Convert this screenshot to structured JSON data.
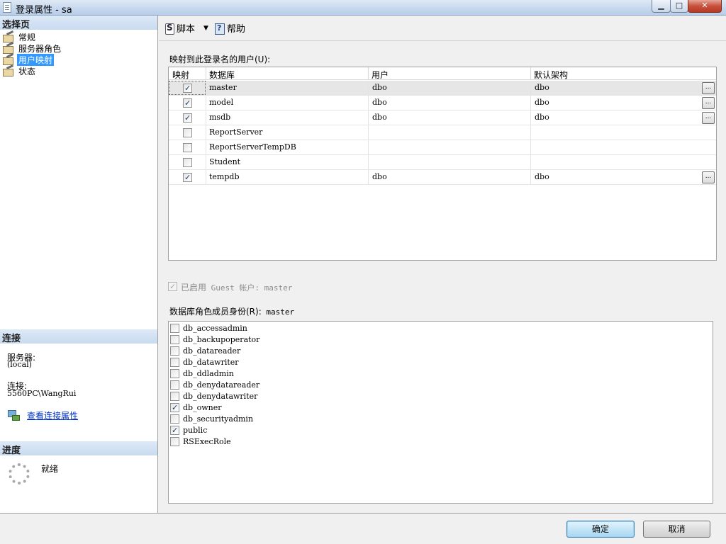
{
  "window": {
    "title": "登录属性 - sa",
    "min_glyph": "▁",
    "max_glyph": "□",
    "close_glyph": "✕"
  },
  "left": {
    "pages_header": "选择页",
    "pages": [
      {
        "label": "常规",
        "selected": false
      },
      {
        "label": "服务器角色",
        "selected": false
      },
      {
        "label": "用户映射",
        "selected": true
      },
      {
        "label": "状态",
        "selected": false
      }
    ],
    "connection_header": "连接",
    "server_label": "服务器:",
    "server_value": "(local)",
    "connection_label": "连接:",
    "connection_value": "5560PC\\WangRui",
    "view_connection_link": "查看连接属性",
    "progress_header": "进度",
    "progress_status": "就绪"
  },
  "toolbar": {
    "script_label": "脚本",
    "dropdown_glyph": "▼",
    "help_label": "帮助"
  },
  "mapping": {
    "caption": "映射到此登录名的用户(U):",
    "columns": [
      "映射",
      "数据库",
      "用户",
      "默认架构"
    ],
    "rows": [
      {
        "mapped": true,
        "database": "master",
        "user": "dbo",
        "schema": "dbo",
        "has_button": true,
        "selected": true
      },
      {
        "mapped": true,
        "database": "model",
        "user": "dbo",
        "schema": "dbo",
        "has_button": true,
        "selected": false
      },
      {
        "mapped": true,
        "database": "msdb",
        "user": "dbo",
        "schema": "dbo",
        "has_button": true,
        "selected": false
      },
      {
        "mapped": false,
        "database": "ReportServer",
        "user": "",
        "schema": "",
        "has_button": false,
        "selected": false
      },
      {
        "mapped": false,
        "database": "ReportServerTempDB",
        "user": "",
        "schema": "",
        "has_button": false,
        "selected": false
      },
      {
        "mapped": false,
        "database": "Student",
        "user": "",
        "schema": "",
        "has_button": false,
        "selected": false
      },
      {
        "mapped": true,
        "database": "tempdb",
        "user": "dbo",
        "schema": "dbo",
        "has_button": true,
        "selected": false
      }
    ],
    "ellipsis_label": "..."
  },
  "guest": {
    "checked": true,
    "label": "已启用",
    "text": " Guest 帐户: master"
  },
  "roles": {
    "caption_prefix": "数据库角色成员身份(R):",
    "caption_db": " master",
    "items": [
      {
        "label": "db_accessadmin",
        "checked": false
      },
      {
        "label": "db_backupoperator",
        "checked": false
      },
      {
        "label": "db_datareader",
        "checked": false
      },
      {
        "label": "db_datawriter",
        "checked": false
      },
      {
        "label": "db_ddladmin",
        "checked": false
      },
      {
        "label": "db_denydatareader",
        "checked": false
      },
      {
        "label": "db_denydatawriter",
        "checked": false
      },
      {
        "label": "db_owner",
        "checked": true
      },
      {
        "label": "db_securityadmin",
        "checked": false
      },
      {
        "label": "public",
        "checked": true
      },
      {
        "label": "RSExecRole",
        "checked": false
      }
    ]
  },
  "footer": {
    "ok_label": "确定",
    "cancel_label": "取消"
  }
}
